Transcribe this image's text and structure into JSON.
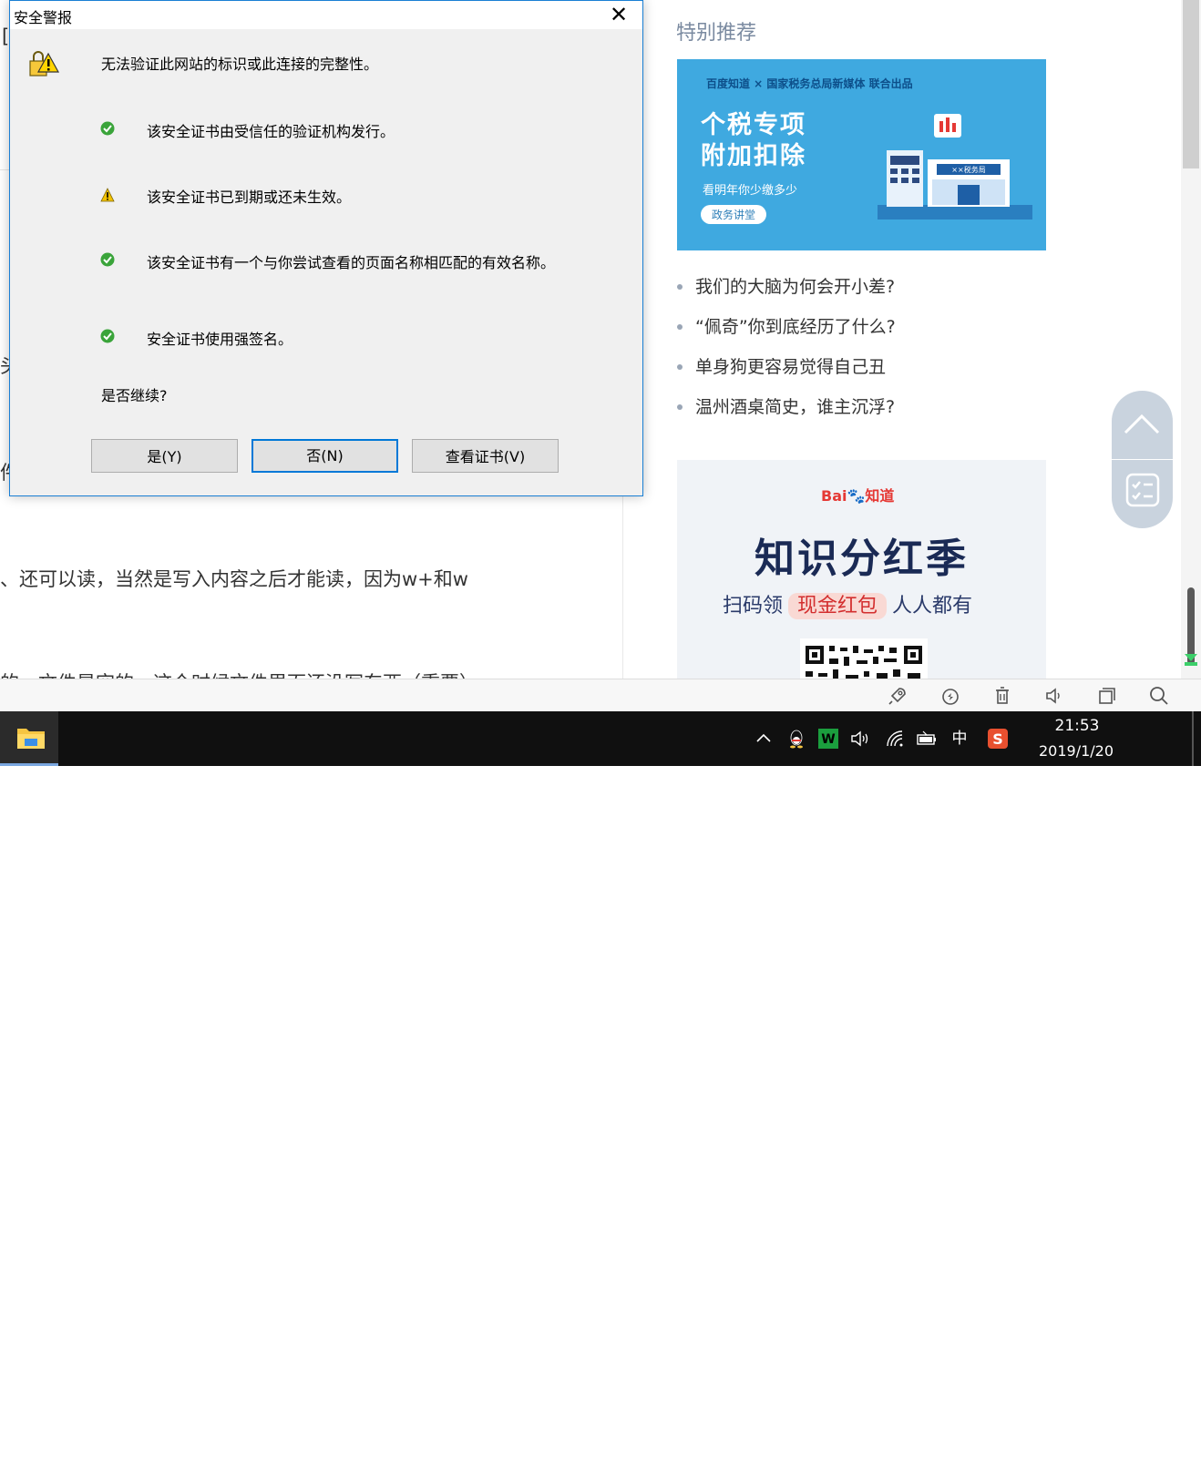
{
  "background_page": {
    "fragments": [
      "[",
      "头",
      "件",
      "、还可以读，当然是写入内容之后才能读，因为w+和w",
      "的，文件是空的，这个时候文件里面还没写东西（重要）"
    ],
    "sidebar": {
      "title": "特别推荐",
      "banner1": {
        "top_text": "百度知道 × 国家税务总局新媒体 联合出品",
        "headline_1": "个税专项",
        "headline_2": "附加扣除",
        "sub_text": "看明年你少缴多少",
        "pill_text": "政务讲堂",
        "building_sign": "××税务局"
      },
      "recommendations": [
        "我们的大脑为何会开小差?",
        "“佩奇”你到底经历了什么?",
        "单身狗更容易觉得自己丑",
        "温州酒桌简史，谁主沉浮?"
      ],
      "banner2": {
        "logo_text": "Bai",
        "logo_text2": "知道",
        "title": "知识分红季",
        "line_prefix": "扫码领",
        "line_highlight": "现金红包",
        "line_suffix": "人人都有"
      }
    }
  },
  "dialog": {
    "title": "安全警报",
    "close_label": "✕",
    "message": "无法验证此网站的标识或此连接的完整性。",
    "rows": [
      {
        "status": "ok",
        "text": "该安全证书由受信任的验证机构发行。"
      },
      {
        "status": "warn",
        "text": "该安全证书已到期或还未生效。"
      },
      {
        "status": "ok",
        "text": "该安全证书有一个与你尝试查看的页面名称相匹配的有效名称。"
      },
      {
        "status": "ok",
        "text": "安全证书使用强签名。"
      }
    ],
    "question": "是否继续?",
    "buttons": {
      "yes": "是(Y)",
      "no": "否(N)",
      "view_cert": "查看证书(V)"
    }
  },
  "taskbar": {
    "ime_label": "中",
    "time": "21:53",
    "date": "2019/1/20"
  },
  "colors": {
    "dialog_border": "#1a7fd4",
    "ok_green": "#3aa43a",
    "warn_yellow": "#f2c200",
    "taskbar": "#101010",
    "banner_blue": "#3fa9e0"
  }
}
